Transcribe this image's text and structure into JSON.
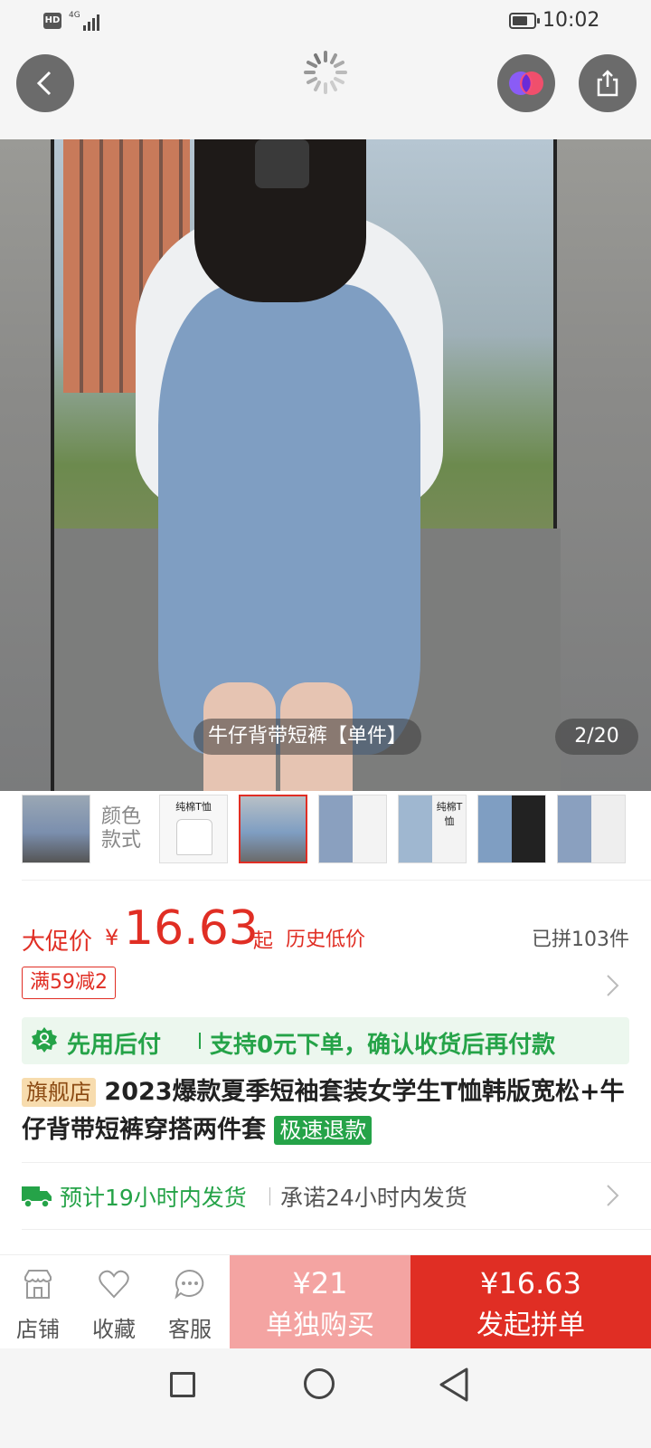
{
  "status_bar": {
    "hd": "HD",
    "network": "4G",
    "time": "10:02"
  },
  "hero": {
    "caption": "牛仔背带短裤【单件】",
    "counter": "2/20"
  },
  "variants": {
    "color_label": "颜色款式",
    "thumb_2_text": "纯棉T恤",
    "thumb_5_text": "纯棉T恤"
  },
  "price": {
    "promo_label": "大促价",
    "currency": "¥",
    "amount": "16.63",
    "suffix": "起",
    "history_low": "历史低价",
    "sold": "已拼103件",
    "coupon": "满59减2"
  },
  "pay_later": {
    "title": "先用后付",
    "detail": "支持0元下单，确认收货后再付款"
  },
  "product": {
    "flag_badge": "旗舰店",
    "title": "2023爆款夏季短袖套装女学生T恤韩版宽松+牛仔背带短裤穿搭两件套",
    "refund_badge": "极速退款"
  },
  "shipping": {
    "estimate": "预计19小时内发货",
    "promise": "承诺24小时内发货"
  },
  "bottom_bar": {
    "store": "店铺",
    "favorite": "收藏",
    "service": "客服",
    "buy_alone_price": "¥21",
    "buy_alone_label": "单独购买",
    "buy_group_price": "¥16.63",
    "buy_group_label": "发起拼单"
  },
  "colors": {
    "accent_red": "#e02e24",
    "pay_later_green": "#25a348",
    "buy_alone_pink": "#f4a4a2"
  }
}
